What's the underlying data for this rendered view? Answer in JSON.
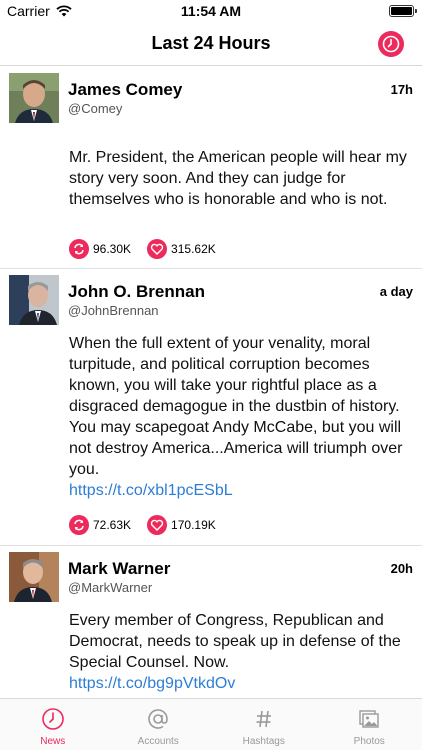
{
  "status_bar": {
    "carrier": "Carrier",
    "time": "11:54 AM"
  },
  "nav": {
    "title": "Last 24 Hours",
    "action_icon": "clock-icon"
  },
  "colors": {
    "accent": "#ec2a5c",
    "link": "#2d7dd6"
  },
  "tweets": [
    {
      "name": "James Comey",
      "handle": "@Comey",
      "time": "17h",
      "text": "Mr. President, the American people will hear my story very soon. And they can judge for themselves who is honorable and who is not.",
      "link": "",
      "retweets": "96.30K",
      "likes": "315.62K"
    },
    {
      "name": "John O. Brennan",
      "handle": "@JohnBrennan",
      "time": "a day",
      "text": "When the full extent of your venality, moral turpitude, and political corruption becomes known, you will take your rightful place as a disgraced demagogue in the dustbin of history. You may scapegoat Andy McCabe, but you will not destroy America...America will triumph over you.",
      "link": "https://t.co/xbl1pcESbL",
      "retweets": "72.63K",
      "likes": "170.19K"
    },
    {
      "name": "Mark Warner",
      "handle": "@MarkWarner",
      "time": "20h",
      "text": "Every member of Congress, Republican and Democrat, needs to speak up in defense of the Special Counsel. Now.",
      "link": "https://t.co/bg9pVtkdOv",
      "retweets": "",
      "likes": ""
    }
  ],
  "tabs": [
    {
      "label": "News",
      "icon": "clock-icon",
      "active": true
    },
    {
      "label": "Accounts",
      "icon": "at-sign-icon",
      "active": false
    },
    {
      "label": "Hashtags",
      "icon": "hashtag-icon",
      "active": false
    },
    {
      "label": "Photos",
      "icon": "photos-icon",
      "active": false
    }
  ]
}
